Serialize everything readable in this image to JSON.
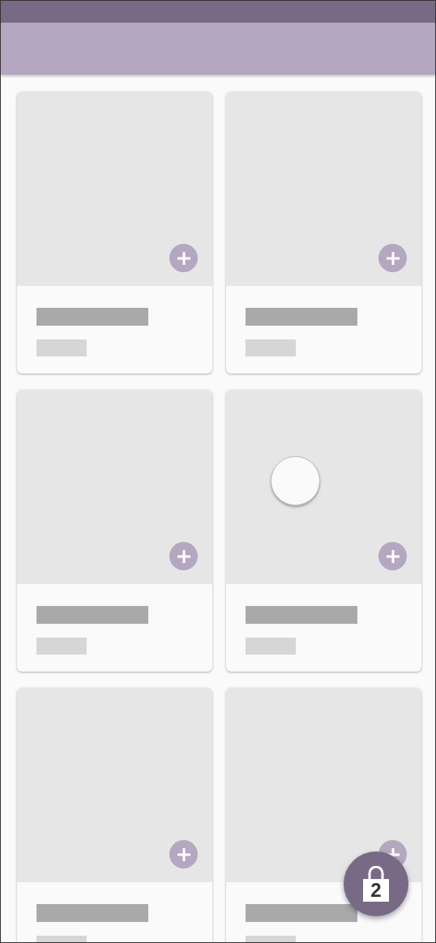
{
  "cards": [
    {
      "pressed": false
    },
    {
      "pressed": false
    },
    {
      "pressed": false
    },
    {
      "pressed": true
    },
    {
      "pressed": false
    },
    {
      "pressed": false
    }
  ],
  "cart_button": {
    "count": "2"
  }
}
